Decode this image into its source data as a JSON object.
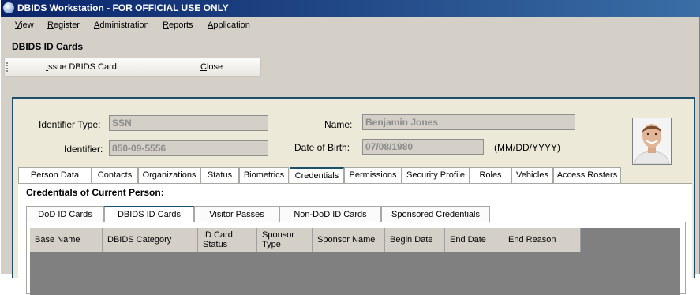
{
  "window": {
    "title": "DBIDS Workstation - FOR OFFICIAL USE ONLY"
  },
  "menu": [
    "View",
    "Register",
    "Administration",
    "Reports",
    "Application"
  ],
  "app_title": "DBIDS ID Cards",
  "toolbar": {
    "issue_label": "Issue DBIDS Card",
    "close_label": "Close"
  },
  "person": {
    "identifier_type_label": "Identifier Type:",
    "identifier_type_value": "SSN",
    "identifier_label": "Identifier:",
    "identifier_value": "850-09-5556",
    "name_label": "Name:",
    "name_value": "Benjamin Jones",
    "dob_label": "Date of Birth:",
    "dob_value": "07/08/1980",
    "dob_format": "(MM/DD/YYYY)"
  },
  "tabs": [
    "Person Data",
    "Contacts",
    "Organizations",
    "Status",
    "Biometrics",
    "Credentials",
    "Permissions",
    "Security Profile",
    "Roles",
    "Vehicles",
    "Access Rosters"
  ],
  "active_tab": "Credentials",
  "credentials": {
    "title": "Credentials of Current Person:",
    "subtabs": [
      "DoD ID Cards",
      "DBIDS ID Cards",
      "Visitor Passes",
      "Non-DoD ID Cards",
      "Sponsored Credentials"
    ],
    "active_subtab": "DBIDS ID Cards",
    "columns": [
      "Base Name",
      "DBIDS Category",
      "ID Card Status",
      "Sponsor Type",
      "Sponsor Name",
      "Begin Date",
      "End Date",
      "End Reason"
    ]
  },
  "colors": {
    "title_start": "#0a246a",
    "title_end": "#3a6ea5",
    "panel_border": "#1c4f6c",
    "grid_bg": "#808080"
  }
}
